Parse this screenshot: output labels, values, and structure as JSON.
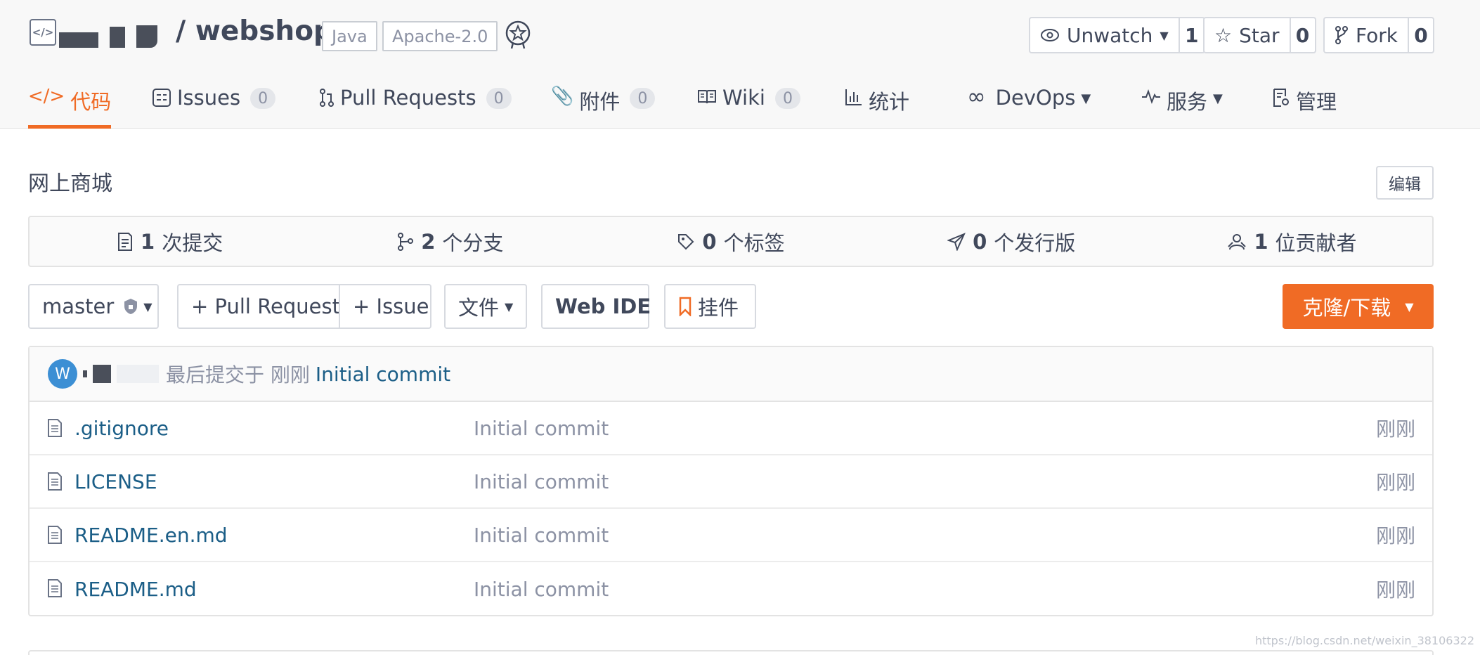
{
  "header": {
    "repo_name": "/ webshop",
    "tags": [
      "Java",
      "Apache-2.0"
    ],
    "actions": [
      {
        "label": "Unwatch",
        "count": "1",
        "icon": "eye-icon"
      },
      {
        "label": "Star",
        "count": "0",
        "icon": "star-icon"
      },
      {
        "label": "Fork",
        "count": "0",
        "icon": "fork-icon"
      }
    ]
  },
  "tabs": [
    {
      "label": "代码",
      "icon": "code-icon",
      "active": true
    },
    {
      "label": "Issues",
      "badge": "0",
      "icon": "issues-icon"
    },
    {
      "label": "Pull Requests",
      "badge": "0",
      "icon": "pull-request-icon"
    },
    {
      "label": "附件",
      "badge": "0",
      "icon": "paperclip-icon"
    },
    {
      "label": "Wiki",
      "badge": "0",
      "icon": "book-icon"
    },
    {
      "label": "统计",
      "icon": "bar-chart-icon"
    },
    {
      "label": "DevOps",
      "icon": "infinity-icon",
      "dropdown": true
    },
    {
      "label": "服务",
      "icon": "pulse-icon",
      "dropdown": true
    },
    {
      "label": "管理",
      "icon": "settings-doc-icon"
    }
  ],
  "description": "网上商城",
  "edit_label": "编辑",
  "stats": [
    {
      "count": "1",
      "label": "次提交",
      "icon": "commit-icon"
    },
    {
      "count": "2",
      "label": "个分支",
      "icon": "branch-icon"
    },
    {
      "count": "0",
      "label": "个标签",
      "icon": "tag-icon"
    },
    {
      "count": "0",
      "label": "个发行版",
      "icon": "send-icon"
    },
    {
      "count": "1",
      "label": "位贡献者",
      "icon": "contributors-icon"
    }
  ],
  "toolbar": {
    "branch": "master",
    "pull_request": "+ Pull Request",
    "issue": "+ Issue",
    "file": "文件",
    "web_ide": "Web IDE",
    "widget": "挂件",
    "clone": "克隆/下载"
  },
  "latest_commit": {
    "avatar_letter": "W",
    "meta": "最后提交于 刚刚",
    "message": "Initial commit"
  },
  "files": [
    {
      "name": ".gitignore",
      "commit": "Initial commit",
      "time": "刚刚"
    },
    {
      "name": "LICENSE",
      "commit": "Initial commit",
      "time": "刚刚"
    },
    {
      "name": "README.en.md",
      "commit": "Initial commit",
      "time": "刚刚"
    },
    {
      "name": "README.md",
      "commit": "Initial commit",
      "time": "刚刚"
    }
  ],
  "watermark": "https://blog.csdn.net/weixin_38106322",
  "colors": {
    "accent": "#f06b25",
    "link": "#1b5e87",
    "avatar": "#3c8fd4"
  }
}
